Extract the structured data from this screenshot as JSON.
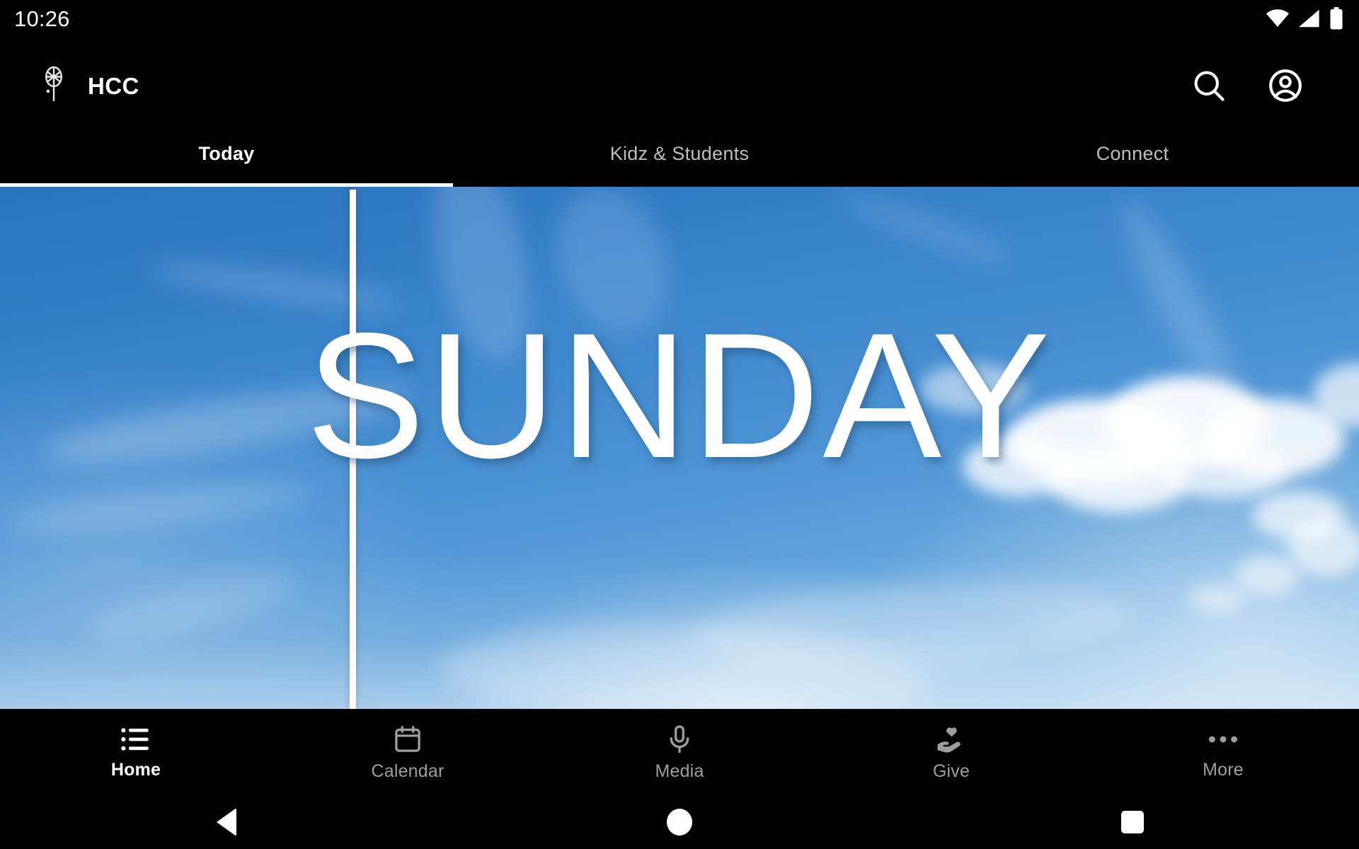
{
  "status_bar": {
    "clock": "10:26",
    "icons": [
      "wifi-icon",
      "cellular-signal-icon",
      "battery-icon"
    ]
  },
  "app_bar": {
    "logo_icon": "hcc-logo-icon",
    "title": "HCC",
    "actions": [
      {
        "icon": "search-icon",
        "name": "search-button"
      },
      {
        "icon": "account-circle-icon",
        "name": "account-button"
      }
    ]
  },
  "tabs": [
    {
      "label": "Today",
      "active": true
    },
    {
      "label": "Kidz & Students",
      "active": false
    },
    {
      "label": "Connect",
      "active": false
    }
  ],
  "hero": {
    "title": "SUNDAY",
    "alt": "blue sky with clouds"
  },
  "bottom_nav": [
    {
      "label": "Home",
      "icon": "list-icon",
      "active": true
    },
    {
      "label": "Calendar",
      "icon": "calendar-icon",
      "active": false
    },
    {
      "label": "Media",
      "icon": "microphone-icon",
      "active": false
    },
    {
      "label": "Give",
      "icon": "hand-heart-icon",
      "active": false
    },
    {
      "label": "More",
      "icon": "more-horizontal-icon",
      "active": false
    }
  ],
  "system_nav": [
    {
      "name": "back-button",
      "icon": "triangle-back-icon"
    },
    {
      "name": "home-button",
      "icon": "circle-home-icon"
    },
    {
      "name": "recents-button",
      "icon": "square-recents-icon"
    }
  ],
  "colors": {
    "background": "#000000",
    "accent": "#ffffff",
    "inactive": "#9e9e9e",
    "sky_top": "#2a72bd",
    "sky_bottom": "#8cc0e8"
  }
}
